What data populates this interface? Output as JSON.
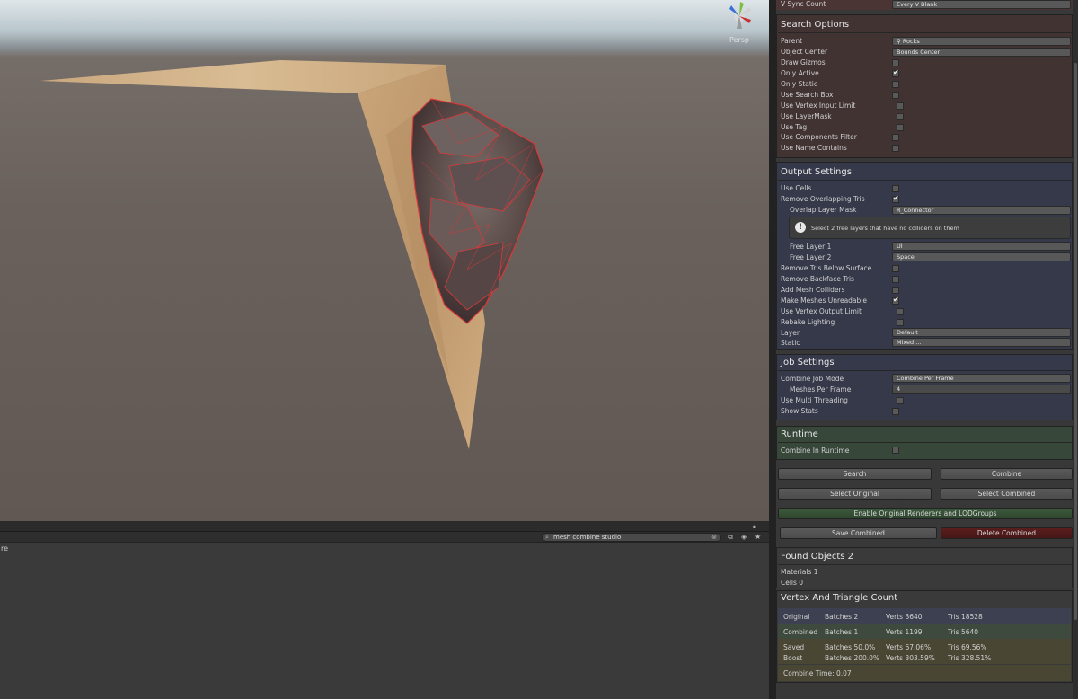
{
  "scene": {
    "persp_label": "Persp"
  },
  "bottom_panel": {
    "left_text": "re",
    "search_value": "mesh combine studio"
  },
  "inspector": {
    "top_row": {
      "label": "V Sync Count",
      "value": "Every V Blank"
    },
    "search_options": {
      "title": "Search Options",
      "parent_label": "Parent",
      "parent_value": "Rocks",
      "object_center_label": "Object Center",
      "object_center_value": "Bounds Center",
      "draw_gizmos": "Draw Gizmos",
      "only_active": "Only Active",
      "only_static": "Only Static",
      "use_search_box": "Use Search Box",
      "use_vertex_input_limit": "Use Vertex Input Limit",
      "use_layermask": "Use LayerMask",
      "use_tag": "Use Tag",
      "use_components_filter": "Use Components Filter",
      "use_name_contains": "Use Name Contains"
    },
    "output_settings": {
      "title": "Output Settings",
      "use_cells": "Use Cells",
      "remove_overlapping_tris": "Remove Overlapping Tris",
      "overlap_layer_mask_label": "Overlap Layer Mask",
      "overlap_layer_mask_value": "R_Connector",
      "help_text": "Select 2 free layers that have no colliders on them",
      "free_layer1_label": "Free Layer 1",
      "free_layer1_value": "UI",
      "free_layer2_label": "Free Layer 2",
      "free_layer2_value": "Space",
      "remove_tris_below_surface": "Remove Tris Below Surface",
      "remove_backface_tris": "Remove Backface Tris",
      "add_mesh_colliders": "Add Mesh Colliders",
      "make_meshes_unreadable": "Make Meshes Unreadable",
      "use_vertex_output_limit": "Use Vertex Output Limit",
      "rebake_lighting": "Rebake Lighting",
      "layer_label": "Layer",
      "layer_value": "Default",
      "static_label": "Static",
      "static_value": "Mixed ..."
    },
    "job_settings": {
      "title": "Job Settings",
      "combine_job_mode_label": "Combine Job Mode",
      "combine_job_mode_value": "Combine Per Frame",
      "meshes_per_frame_label": "Meshes Per Frame",
      "meshes_per_frame_value": "4",
      "use_multi_threading": "Use Multi Threading",
      "show_stats": "Show Stats"
    },
    "runtime": {
      "title": "Runtime",
      "combine_in_runtime": "Combine In Runtime"
    },
    "buttons": {
      "search": "Search",
      "combine": "Combine",
      "select_original": "Select Original",
      "select_combined": "Select Combined",
      "enable_original": "Enable Original Renderers and LODGroups",
      "save_combined": "Save Combined",
      "delete_combined": "Delete Combined"
    },
    "found": {
      "title": "Found Objects 2",
      "materials": "Materials 1",
      "cells": "Cells 0"
    },
    "counts": {
      "title": "Vertex And Triangle Count",
      "original": {
        "label": "Original",
        "batches": "Batches 2",
        "verts": "Verts 3640",
        "tris": "Tris 18528"
      },
      "combined": {
        "label": "Combined",
        "batches": "Batches 1",
        "verts": "Verts 1199",
        "tris": "Tris 5640"
      },
      "saved": {
        "label": "Saved",
        "batches": "Batches 50.0%",
        "verts": "Verts 67.06%",
        "tris": "Tris 69.56%"
      },
      "boost": {
        "label": "Boost",
        "batches": "Batches 200.0%",
        "verts": "Verts 303.59%",
        "tris": "Tris 328.51%"
      },
      "combine_time": "Combine Time: 0.07"
    }
  }
}
